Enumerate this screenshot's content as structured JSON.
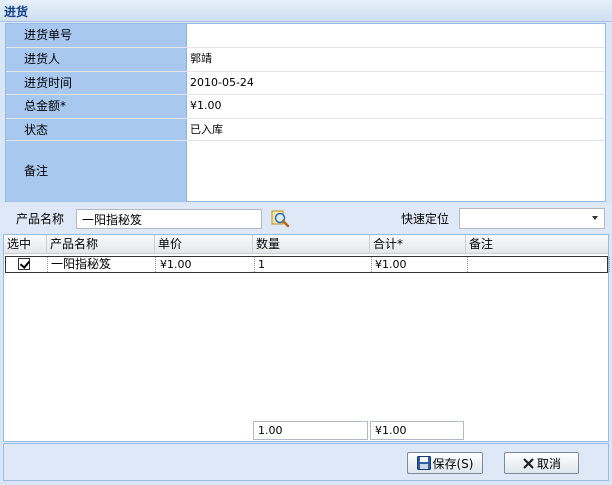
{
  "window": {
    "title": "进货"
  },
  "form": {
    "rows": [
      {
        "label": "进货单号",
        "value": ""
      },
      {
        "label": "进货人",
        "value": "郭靖"
      },
      {
        "label": "进货时间",
        "value": "2010-05-24"
      },
      {
        "label": "总金额*",
        "value": "¥1.00"
      },
      {
        "label": "状态",
        "value": "已入库"
      },
      {
        "label": "备注",
        "value": ""
      }
    ]
  },
  "search": {
    "product_label": "产品名称",
    "product_value": "一阳指秘笈",
    "quick_label": "快速定位",
    "quick_value": ""
  },
  "grid": {
    "columns": [
      "选中",
      "产品名称",
      "单价",
      "数量",
      "合计*",
      "备注"
    ],
    "rows": [
      {
        "checked": true,
        "product": "一阳指秘笈",
        "price": "¥1.00",
        "qty": "1",
        "total": "¥1.00",
        "note": ""
      }
    ],
    "summary": {
      "qty": "1.00",
      "total": "¥1.00"
    }
  },
  "footer": {
    "save_label": "保存(S)",
    "cancel_label": "取消"
  }
}
